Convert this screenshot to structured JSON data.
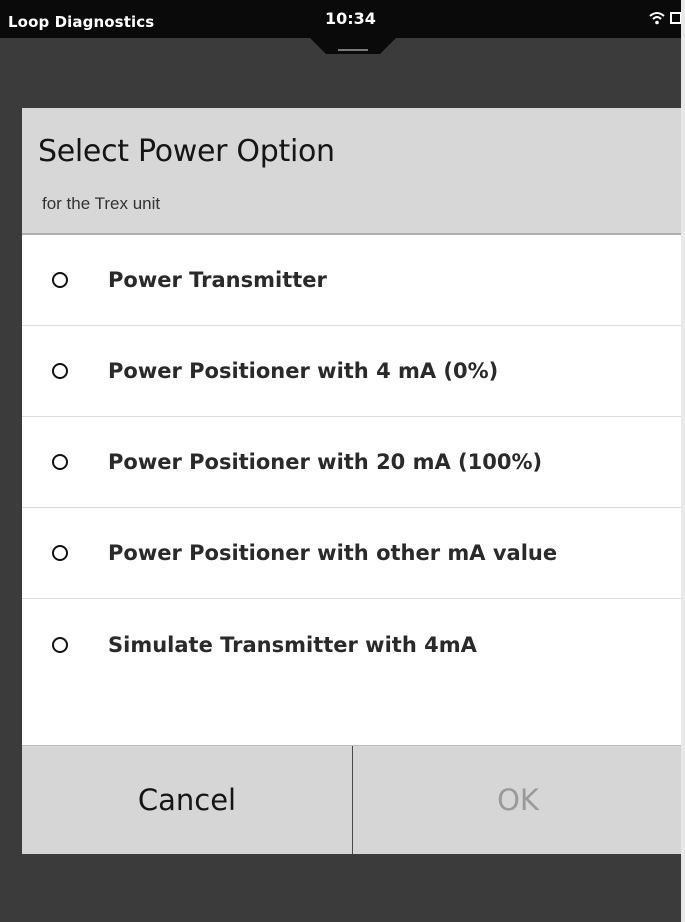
{
  "status_bar": {
    "app_name": "Loop Diagnostics",
    "time": "10:34",
    "icons": [
      "wifi-icon",
      "battery-icon"
    ]
  },
  "dialog": {
    "title": "Select Power Option",
    "subtitle": "for the Trex unit",
    "options": [
      {
        "label": "Power Transmitter",
        "selected": false
      },
      {
        "label": "Power Positioner with 4 mA (0%)",
        "selected": false
      },
      {
        "label": "Power Positioner with 20 mA (100%)",
        "selected": false
      },
      {
        "label": "Power Positioner with other mA value",
        "selected": false
      },
      {
        "label": "Simulate Transmitter with 4mA",
        "selected": false
      }
    ],
    "cancel_label": "Cancel",
    "ok_label": "OK",
    "ok_enabled": false
  },
  "colors": {
    "status_bar_bg": "#0a0a0a",
    "device_bg": "#3b3b3b",
    "header_bg": "#d7d7d7",
    "button_bg": "#d6d6d6",
    "disabled_text": "#9a9a9a"
  }
}
